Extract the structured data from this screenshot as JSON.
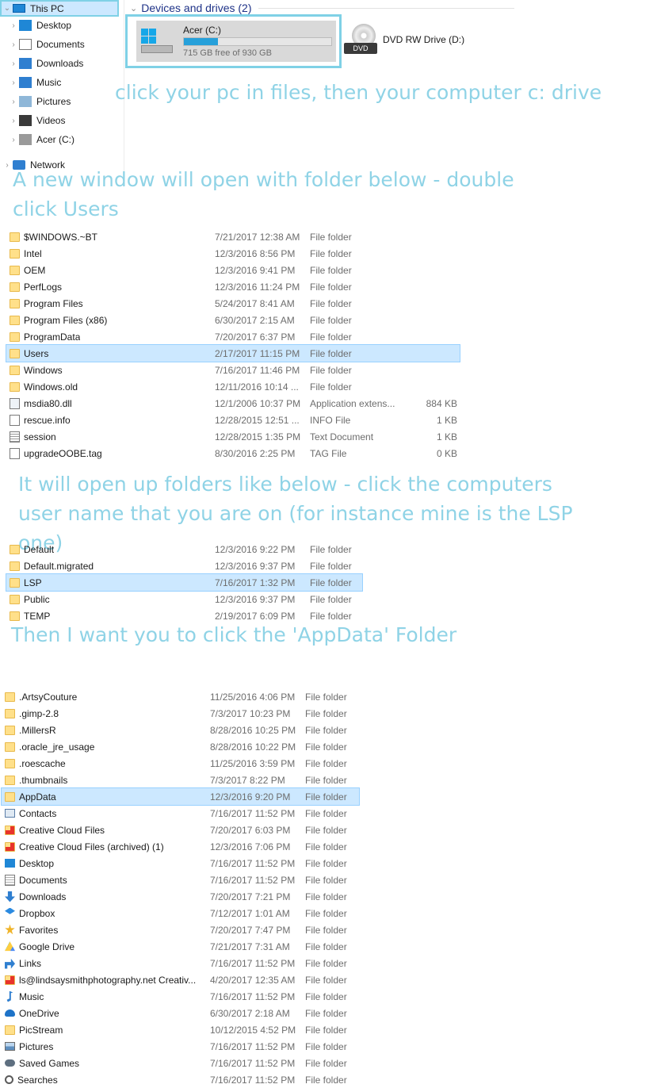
{
  "nav": {
    "this_pc": "This PC",
    "items": [
      {
        "label": "Desktop",
        "icon": "desktop-icon"
      },
      {
        "label": "Documents",
        "icon": "documents-icon"
      },
      {
        "label": "Downloads",
        "icon": "downloads-icon"
      },
      {
        "label": "Music",
        "icon": "music-icon"
      },
      {
        "label": "Pictures",
        "icon": "pictures-icon"
      },
      {
        "label": "Videos",
        "icon": "videos-icon"
      },
      {
        "label": "Acer (C:)",
        "icon": "drive-icon"
      }
    ],
    "network": "Network"
  },
  "drives": {
    "header": "Devices and drives (2)",
    "c_drive": {
      "name": "Acer (C:)",
      "free_text": "715 GB free of 930 GB",
      "used_fraction": 0.231
    },
    "dvd": {
      "name": "DVD RW Drive (D:)",
      "badge": "DVD"
    }
  },
  "captions": {
    "step1": "click your pc in files, then your computer c: drive",
    "step2_line1": "A new window will open with folder below - double",
    "step2_line2": "click Users",
    "step3_line1": "It will open up folders like below - click the computers",
    "step3_line2": "user name that you are on (for instance mine is the LSP",
    "step3_line3": "one)",
    "step4": "Then I want you to click the 'AppData' Folder"
  },
  "c_root": [
    {
      "name": "$WINDOWS.~BT",
      "date": "7/21/2017 12:38 AM",
      "type": "File folder",
      "size": "",
      "icon": "folder-icon"
    },
    {
      "name": "Intel",
      "date": "12/3/2016 8:56 PM",
      "type": "File folder",
      "size": "",
      "icon": "folder-icon"
    },
    {
      "name": "OEM",
      "date": "12/3/2016 9:41 PM",
      "type": "File folder",
      "size": "",
      "icon": "folder-icon"
    },
    {
      "name": "PerfLogs",
      "date": "12/3/2016 11:24 PM",
      "type": "File folder",
      "size": "",
      "icon": "folder-icon"
    },
    {
      "name": "Program Files",
      "date": "5/24/2017 8:41 AM",
      "type": "File folder",
      "size": "",
      "icon": "folder-icon"
    },
    {
      "name": "Program Files (x86)",
      "date": "6/30/2017 2:15 AM",
      "type": "File folder",
      "size": "",
      "icon": "folder-icon"
    },
    {
      "name": "ProgramData",
      "date": "7/20/2017 6:37 PM",
      "type": "File folder",
      "size": "",
      "icon": "folder-icon"
    },
    {
      "name": "Users",
      "date": "2/17/2017 11:15 PM",
      "type": "File folder",
      "size": "",
      "icon": "folder-icon",
      "selected": true
    },
    {
      "name": "Windows",
      "date": "7/16/2017 11:46 PM",
      "type": "File folder",
      "size": "",
      "icon": "folder-icon"
    },
    {
      "name": "Windows.old",
      "date": "12/11/2016 10:14 ...",
      "type": "File folder",
      "size": "",
      "icon": "folder-icon"
    },
    {
      "name": "msdia80.dll",
      "date": "12/1/2006 10:37 PM",
      "type": "Application extens...",
      "size": "884 KB",
      "icon": "dll-icon"
    },
    {
      "name": "rescue.info",
      "date": "12/28/2015 12:51 ...",
      "type": "INFO File",
      "size": "1 KB",
      "icon": "file-icon"
    },
    {
      "name": "session",
      "date": "12/28/2015 1:35 PM",
      "type": "Text Document",
      "size": "1 KB",
      "icon": "text-file-icon"
    },
    {
      "name": "upgradeOOBE.tag",
      "date": "8/30/2016 2:25 PM",
      "type": "TAG File",
      "size": "0 KB",
      "icon": "file-icon"
    }
  ],
  "users": [
    {
      "name": "Default",
      "date": "12/3/2016 9:22 PM",
      "type": "File folder",
      "icon": "folder-icon"
    },
    {
      "name": "Default.migrated",
      "date": "12/3/2016 9:37 PM",
      "type": "File folder",
      "icon": "folder-icon"
    },
    {
      "name": "LSP",
      "date": "7/16/2017 1:32 PM",
      "type": "File folder",
      "icon": "folder-icon",
      "selected": true
    },
    {
      "name": "Public",
      "date": "12/3/2016 9:37 PM",
      "type": "File folder",
      "icon": "folder-icon"
    },
    {
      "name": "TEMP",
      "date": "2/19/2017 6:09 PM",
      "type": "File folder",
      "icon": "folder-icon"
    }
  ],
  "lsp": [
    {
      "name": ".ArtsyCouture",
      "date": "11/25/2016 4:06 PM",
      "type": "File folder",
      "icon": "folder-icon"
    },
    {
      "name": ".gimp-2.8",
      "date": "7/3/2017 10:23 PM",
      "type": "File folder",
      "icon": "folder-icon"
    },
    {
      "name": ".MillersR",
      "date": "8/28/2016 10:25 PM",
      "type": "File folder",
      "icon": "folder-icon"
    },
    {
      "name": ".oracle_jre_usage",
      "date": "8/28/2016 10:22 PM",
      "type": "File folder",
      "icon": "folder-icon"
    },
    {
      "name": ".roescache",
      "date": "11/25/2016 3:59 PM",
      "type": "File folder",
      "icon": "folder-icon"
    },
    {
      "name": ".thumbnails",
      "date": "7/3/2017 8:22 PM",
      "type": "File folder",
      "icon": "folder-icon"
    },
    {
      "name": "AppData",
      "date": "12/3/2016 9:20 PM",
      "type": "File folder",
      "icon": "folder-icon",
      "selected": true
    },
    {
      "name": "Contacts",
      "date": "7/16/2017 11:52 PM",
      "type": "File folder",
      "icon": "contacts-icon"
    },
    {
      "name": "Creative Cloud Files",
      "date": "7/20/2017 6:03 PM",
      "type": "File folder",
      "icon": "creative-cloud-folder-icon"
    },
    {
      "name": "Creative Cloud Files (archived) (1)",
      "date": "12/3/2016 7:06 PM",
      "type": "File folder",
      "icon": "creative-cloud-folder-icon"
    },
    {
      "name": "Desktop",
      "date": "7/16/2017 11:52 PM",
      "type": "File folder",
      "icon": "desktop-icon"
    },
    {
      "name": "Documents",
      "date": "7/16/2017 11:52 PM",
      "type": "File folder",
      "icon": "documents-icon"
    },
    {
      "name": "Downloads",
      "date": "7/20/2017 7:21 PM",
      "type": "File folder",
      "icon": "downloads-icon"
    },
    {
      "name": "Dropbox",
      "date": "7/12/2017 1:01 AM",
      "type": "File folder",
      "icon": "dropbox-icon"
    },
    {
      "name": "Favorites",
      "date": "7/20/2017 7:47 PM",
      "type": "File folder",
      "icon": "favorites-star-icon"
    },
    {
      "name": "Google Drive",
      "date": "7/21/2017 7:31 AM",
      "type": "File folder",
      "icon": "google-drive-icon"
    },
    {
      "name": "Links",
      "date": "7/16/2017 11:52 PM",
      "type": "File folder",
      "icon": "links-icon"
    },
    {
      "name": "ls@lindsaysmithphotography.net Creativ...",
      "date": "4/20/2017 12:35 AM",
      "type": "File folder",
      "icon": "creative-cloud-folder-icon"
    },
    {
      "name": "Music",
      "date": "7/16/2017 11:52 PM",
      "type": "File folder",
      "icon": "music-icon"
    },
    {
      "name": "OneDrive",
      "date": "6/30/2017 2:18 AM",
      "type": "File folder",
      "icon": "onedrive-icon"
    },
    {
      "name": "PicStream",
      "date": "10/12/2015 4:52 PM",
      "type": "File folder",
      "icon": "folder-icon"
    },
    {
      "name": "Pictures",
      "date": "7/16/2017 11:52 PM",
      "type": "File folder",
      "icon": "pictures-icon"
    },
    {
      "name": "Saved Games",
      "date": "7/16/2017 11:52 PM",
      "type": "File folder",
      "icon": "saved-games-icon"
    },
    {
      "name": "Searches",
      "date": "7/16/2017 11:52 PM",
      "type": "File folder",
      "icon": "search-icon"
    }
  ],
  "colors": {
    "caption": "#8fd3e6",
    "selection": "#cce8ff",
    "highlight_box": "#7fd1e6",
    "drive_bar": "#26a0da"
  }
}
